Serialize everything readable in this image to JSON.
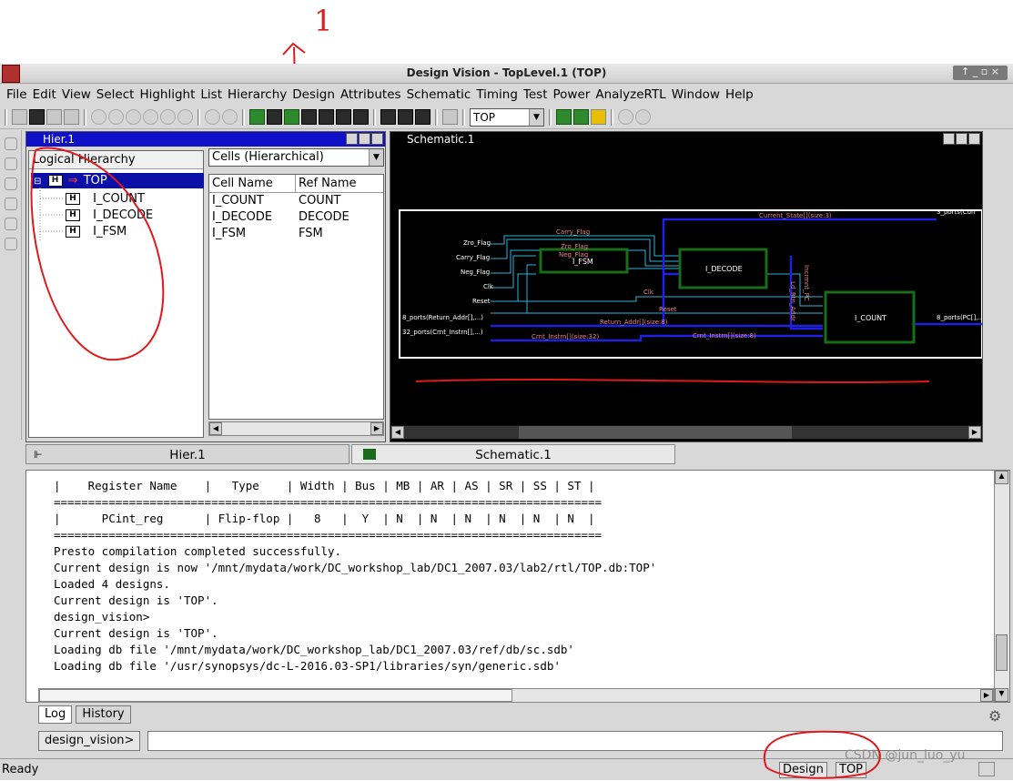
{
  "annotations": {
    "note_mark": "1"
  },
  "window": {
    "title": "Design Vision - TopLevel.1 (TOP)"
  },
  "menu": [
    "File",
    "Edit",
    "View",
    "Select",
    "Highlight",
    "List",
    "Hierarchy",
    "Design",
    "Attributes",
    "Schematic",
    "Timing",
    "Test",
    "Power",
    "AnalyzeRTL",
    "Window",
    "Help"
  ],
  "toolbar": {
    "design_select": "TOP"
  },
  "hier_window": {
    "title": "Hier.1",
    "tree_header": "Logical Hierarchy",
    "tree": [
      {
        "label": "TOP",
        "badge": "H",
        "selected": true
      },
      {
        "label": "I_COUNT",
        "badge": "H"
      },
      {
        "label": "I_DECODE",
        "badge": "H"
      },
      {
        "label": "I_FSM",
        "badge": "H"
      }
    ],
    "cells_dropdown": "Cells (Hierarchical)",
    "cells_headers": [
      "Cell Name",
      "Ref Name"
    ],
    "cells_rows": [
      [
        "I_COUNT",
        "COUNT"
      ],
      [
        "I_DECODE",
        "DECODE"
      ],
      [
        "I_FSM",
        "FSM"
      ]
    ]
  },
  "schematic_window": {
    "title": "Schematic.1",
    "blocks": [
      "I_FSM",
      "I_DECODE",
      "I_COUNT"
    ],
    "net_labels": [
      "Carry_Flag",
      "Zro_Flag",
      "Neg_Flag",
      "Current_State[](size:3)",
      "Clk",
      "Reset",
      "Return_Addr[](size:8)",
      "Crnt_Instrn[](size:32)",
      "Crnt_Instrn[](size:8)",
      "Incrmnt_PC",
      "Ld_Rtn_Addr"
    ],
    "port_labels": [
      "Zro_Flag",
      "Carry_Flag",
      "Neg_Flag",
      "Clk",
      "Reset",
      "8_ports(Return_Addr[],...)",
      "32_ports(Crnt_Instrn[],...)",
      "3_ports(Curr",
      "8_ports(PC[],..."
    ]
  },
  "tabs": {
    "hier": "Hier.1",
    "schematic": "Schematic.1"
  },
  "console": {
    "lines": [
      "|    Register Name    |   Type    | Width | Bus | MB | AR | AS | SR | SS | ST |",
      "================================================================================",
      "|      PCint_reg      | Flip-flop |   8   |  Y  | N  | N  | N  | N  | N  | N  |",
      "================================================================================",
      "Presto compilation completed successfully.",
      "Current design is now '/mnt/mydata/work/DC_workshop_lab/DC1_2007.03/lab2/rtl/TOP.db:TOP'",
      "Loaded 4 designs.",
      "Current design is 'TOP'.",
      "design_vision>",
      "Current design is 'TOP'.",
      "Loading db file '/mnt/mydata/work/DC_workshop_lab/DC1_2007.03/ref/db/sc.sdb'",
      "Loading db file '/usr/synopsys/dc-L-2016.03-SP1/libraries/syn/generic.sdb'"
    ],
    "tab_log": "Log",
    "tab_history": "History",
    "prompt_label": "design_vision>",
    "command_value": ""
  },
  "status": {
    "text": "Ready",
    "design_label": "Design",
    "design_value": "TOP",
    "watermark": "CSDN @jun_luo_yu"
  },
  "colors": {
    "annotation": "#e0191d",
    "title_active": "#1010c8",
    "block_border": "#1a6b1a",
    "wire_cyan": "#2cb5d8",
    "wire_blue": "#2020e0",
    "net_label": "#e88080"
  }
}
